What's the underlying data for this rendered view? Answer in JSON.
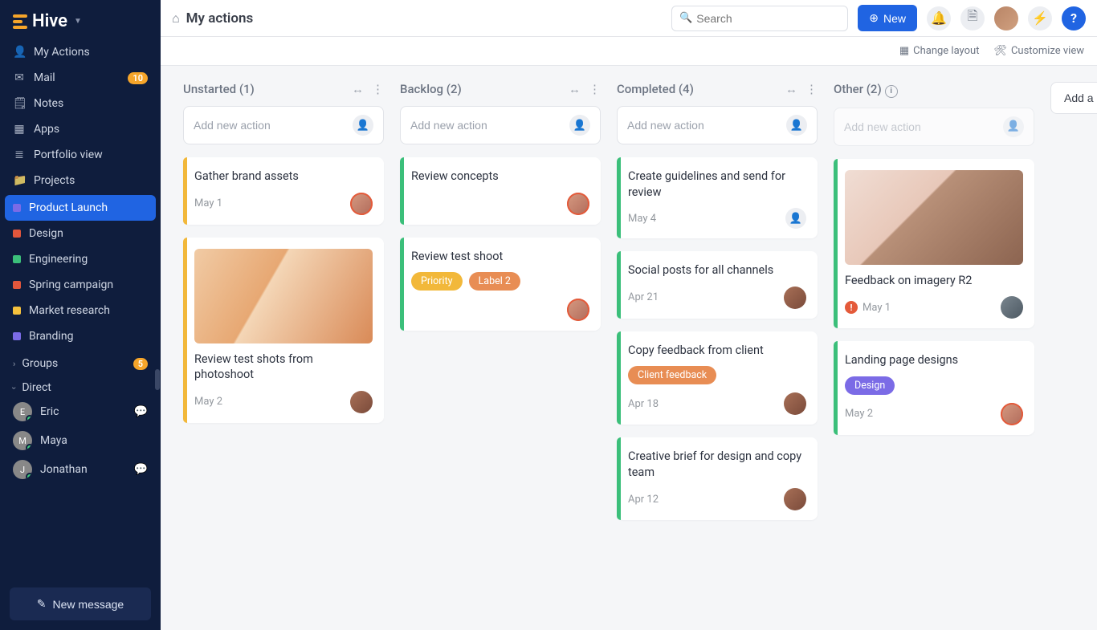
{
  "app": {
    "name": "Hive"
  },
  "header": {
    "title": "My actions",
    "search_placeholder": "Search",
    "new_button": "New",
    "change_layout": "Change layout",
    "customize_view": "Customize view"
  },
  "sidebar": {
    "nav": [
      {
        "icon": "👤",
        "label": "My Actions"
      },
      {
        "icon": "✉",
        "label": "Mail",
        "badge": "10"
      },
      {
        "icon": "🗒",
        "label": "Notes"
      },
      {
        "icon": "▦",
        "label": "Apps"
      },
      {
        "icon": "≣",
        "label": "Portfolio view"
      },
      {
        "icon": "📁",
        "label": "Projects"
      }
    ],
    "projects": [
      {
        "color": "purple",
        "label": "Product Launch",
        "active": true
      },
      {
        "color": "red",
        "label": "Design"
      },
      {
        "color": "green",
        "label": "Engineering"
      },
      {
        "color": "red",
        "label": "Spring campaign"
      },
      {
        "color": "yellow",
        "label": "Market research"
      },
      {
        "color": "purple",
        "label": "Branding"
      }
    ],
    "groups": {
      "label": "Groups",
      "badge": "5"
    },
    "direct": {
      "label": "Direct"
    },
    "dms": [
      {
        "name": "Eric",
        "unread": true
      },
      {
        "name": "Maya"
      },
      {
        "name": "Jonathan",
        "unread": true
      }
    ],
    "new_message": "New message"
  },
  "board": {
    "add_placeholder": "Add new action",
    "add_column": "Add a new",
    "columns": [
      {
        "title": "Unstarted (1)",
        "stripe": "yellow",
        "cards": [
          {
            "title": "Gather brand assets",
            "date": "May 1",
            "avatar": "a1",
            "ring": true
          },
          {
            "title": "Review test shots from photoshoot",
            "date": "May 2",
            "avatar": "a2",
            "image": "bag"
          }
        ]
      },
      {
        "title": "Backlog (2)",
        "stripe": "green",
        "cards": [
          {
            "title": "Review concepts",
            "avatar": "a1",
            "ring": true
          },
          {
            "title": "Review test shoot",
            "labels": [
              {
                "text": "Priority",
                "class": "priority"
              },
              {
                "text": "Label 2",
                "class": "label2"
              }
            ],
            "avatar": "a1",
            "ring": true
          }
        ]
      },
      {
        "title": "Completed (4)",
        "stripe": "green",
        "cards": [
          {
            "title": "Create guidelines and send for review",
            "date": "May 4",
            "avatar_ph": true
          },
          {
            "title": "Social posts for all channels",
            "date": "Apr 21",
            "avatar": "a2"
          },
          {
            "title": "Copy feedback from client",
            "labels": [
              {
                "text": "Client feedback",
                "class": "client"
              }
            ],
            "date": "Apr 18",
            "avatar": "a2"
          },
          {
            "title": "Creative brief for design and copy team",
            "date": "Apr 12",
            "avatar": "a2"
          }
        ]
      },
      {
        "title": "Other (2)",
        "stripe": "green",
        "info": true,
        "disabled_add": true,
        "cards": [
          {
            "title": "Feedback on imagery R2",
            "date": "May 1",
            "urgent": true,
            "avatar": "a3",
            "image": "flat"
          },
          {
            "title": "Landing page designs",
            "labels": [
              {
                "text": "Design",
                "class": "design"
              }
            ],
            "date": "May 2",
            "avatar": "a1",
            "ring": true
          }
        ]
      }
    ]
  }
}
